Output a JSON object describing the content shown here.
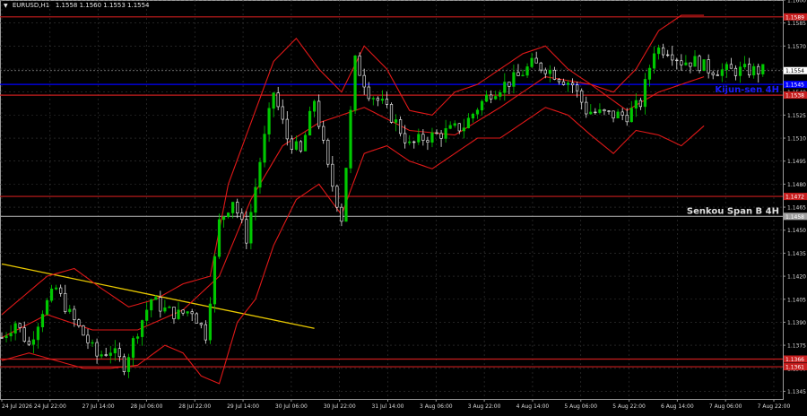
{
  "header": {
    "symbol": "EURUSD,H1",
    "ohlc": "1.1558 1.1560 1.1553 1.1554"
  },
  "chart_data": {
    "type": "candlestick",
    "symbol": "EURUSD,H1",
    "ylim": [
      1.134,
      1.16
    ],
    "yticks": [
      "1.1600",
      "1.1585",
      "1.1570",
      "1.1555",
      "1.1540",
      "1.1525",
      "1.1510",
      "1.1495",
      "1.1480",
      "1.1465",
      "1.1450",
      "1.1435",
      "1.1420",
      "1.1405",
      "1.1390",
      "1.1375",
      "1.1360",
      "1.1345"
    ],
    "xticks": [
      "24 Jul 2026",
      "24 Jul 22:00",
      "27 Jul 14:00",
      "28 Jul 06:00",
      "28 Jul 22:00",
      "29 Jul 14:00",
      "30 Jul 06:00",
      "30 Jul 22:00",
      "31 Jul 14:00",
      "3 Aug 06:00",
      "3 Aug 22:00",
      "4 Aug 14:00",
      "5 Aug 06:00",
      "5 Aug 22:00",
      "6 Aug 14:00",
      "7 Aug 06:00",
      "7 Aug 22:00"
    ],
    "current_price": {
      "value": 1.1554,
      "label": "1.1554"
    },
    "levels": [
      {
        "value": 1.1589,
        "label": "1.1589",
        "color": "#c81e1e",
        "style": "solid"
      },
      {
        "value": 1.1545,
        "label": "1.1545",
        "color": "#0000ff",
        "style": "solid",
        "note": ""
      },
      {
        "value": 1.1538,
        "label": "1.1538",
        "color": "#c81e1e",
        "style": "solid",
        "note": "Kijun-sen 4H"
      },
      {
        "value": 1.1472,
        "label": "1.1472",
        "color": "#c81e1e",
        "style": "solid"
      },
      {
        "value": 1.1459,
        "label": "1.1458",
        "color": "#a0a0a0",
        "style": "solid",
        "note": "Senkou Span B 4H"
      },
      {
        "value": 1.1366,
        "label": "1.1366",
        "color": "#c81e1e",
        "style": "solid"
      },
      {
        "value": 1.1361,
        "label": "1.1361",
        "color": "#c81e1e",
        "style": "solid"
      }
    ],
    "trendline": {
      "x": [
        0,
        69
      ],
      "y": [
        1.1428,
        1.1386
      ],
      "color": "#e8c800"
    },
    "series": [
      {
        "name": "",
        "kind": "close",
        "x": [
          0,
          3,
          6,
          9,
          12,
          15,
          18,
          21,
          24,
          27,
          30,
          33,
          36,
          39,
          42,
          45,
          48,
          51,
          54,
          57,
          60,
          63,
          66,
          69,
          72,
          75,
          78,
          81,
          84,
          87,
          90,
          93,
          96,
          99,
          102,
          105,
          108,
          111,
          114,
          117,
          120,
          123,
          126,
          129,
          132,
          135,
          138,
          141,
          144,
          147,
          150,
          153,
          156,
          159,
          160,
          163,
          166,
          169
        ],
        "y": [
          1.138,
          1.139,
          1.1375,
          1.1398,
          1.1412,
          1.1395,
          1.1382,
          1.1368,
          1.1372,
          1.1362,
          1.1385,
          1.1405,
          1.1398,
          1.1395,
          1.1398,
          1.1382,
          1.1455,
          1.147,
          1.1445,
          1.1495,
          1.154,
          1.151,
          1.15,
          1.1535,
          1.149,
          1.1458,
          1.156,
          1.154,
          1.1532,
          1.152,
          1.1505,
          1.151,
          1.1512,
          1.1515,
          1.1518,
          1.153,
          1.154,
          1.1545,
          1.155,
          1.1558,
          1.1556,
          1.155,
          1.1545,
          1.1528,
          1.1526,
          1.1525,
          1.1525,
          1.1533,
          1.1568,
          1.1568,
          1.156,
          1.156,
          1.1555,
          1.1554,
          1.1554,
          1.1554,
          1.1554,
          1.1554
        ]
      },
      {
        "name": "",
        "kind": "band_mid",
        "x": [
          0,
          10,
          20,
          30,
          40,
          48,
          55,
          62,
          70,
          80,
          90,
          100,
          110,
          120,
          130,
          138,
          145,
          155
        ],
        "y": [
          1.138,
          1.1395,
          1.1385,
          1.1385,
          1.1398,
          1.142,
          1.147,
          1.1505,
          1.152,
          1.153,
          1.1515,
          1.1512,
          1.153,
          1.155,
          1.1545,
          1.1528,
          1.154,
          1.155
        ]
      },
      {
        "name": "",
        "kind": "band_upper",
        "x": [
          0,
          10,
          16,
          22,
          28,
          34,
          40,
          46,
          50,
          55,
          60,
          65,
          70,
          75,
          80,
          85,
          90,
          95,
          100,
          105,
          110,
          115,
          120,
          125,
          130,
          135,
          140,
          145,
          150,
          155
        ],
        "y": [
          1.1395,
          1.142,
          1.1425,
          1.1412,
          1.14,
          1.1405,
          1.1415,
          1.142,
          1.148,
          1.152,
          1.156,
          1.1575,
          1.1555,
          1.154,
          1.157,
          1.1555,
          1.1528,
          1.1525,
          1.154,
          1.1545,
          1.1555,
          1.1565,
          1.157,
          1.1555,
          1.1545,
          1.154,
          1.1555,
          1.158,
          1.159,
          1.159
        ]
      },
      {
        "name": "",
        "kind": "band_lower",
        "x": [
          0,
          6,
          12,
          18,
          24,
          30,
          36,
          40,
          44,
          48,
          52,
          56,
          60,
          65,
          70,
          75,
          80,
          85,
          90,
          95,
          100,
          105,
          110,
          115,
          120,
          125,
          130,
          135,
          140,
          145,
          150,
          155
        ],
        "y": [
          1.1365,
          1.137,
          1.1365,
          1.136,
          1.136,
          1.1362,
          1.1375,
          1.137,
          1.1355,
          1.135,
          1.139,
          1.1405,
          1.144,
          1.147,
          1.148,
          1.146,
          1.15,
          1.1505,
          1.1495,
          1.149,
          1.15,
          1.151,
          1.151,
          1.152,
          1.153,
          1.1525,
          1.1512,
          1.15,
          1.1515,
          1.1512,
          1.1505,
          1.1518
        ]
      }
    ]
  }
}
